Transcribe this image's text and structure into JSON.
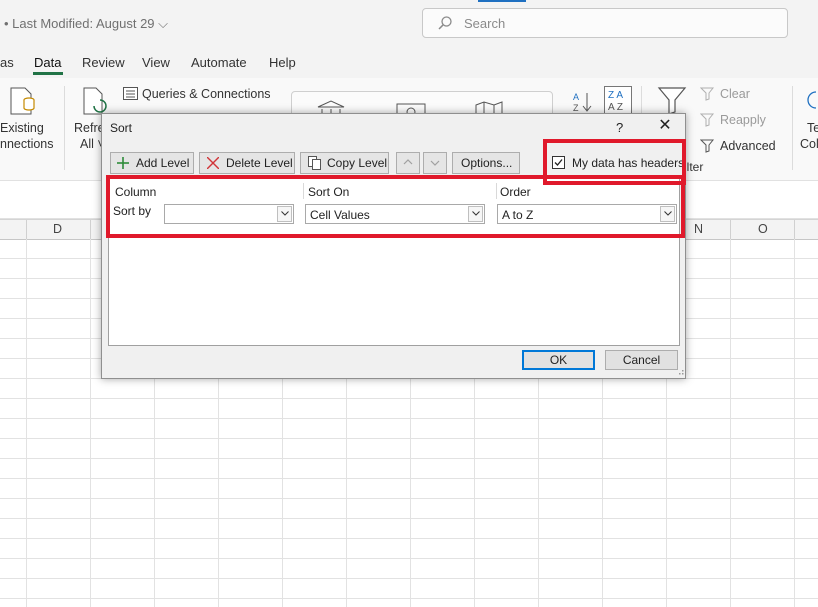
{
  "titlebar": {
    "last_modified": "• Last Modified: August 29 ⌵",
    "search_placeholder": "Search"
  },
  "menu_tabs": [
    {
      "label": "as"
    },
    {
      "label": "Data"
    },
    {
      "label": "Review"
    },
    {
      "label": "View"
    },
    {
      "label": "Automate"
    },
    {
      "label": "Help"
    }
  ],
  "ribbon": {
    "existing_connections": [
      "Existing",
      "nnections"
    ],
    "refresh_all": [
      "Refre",
      "All ˅"
    ],
    "queries_connections": "Queries & Connections",
    "clear": "Clear",
    "reapply": "Reapply",
    "advanced": "Advanced",
    "filter_fragment": "ilter",
    "text_to_columns": [
      "Te",
      "Col"
    ]
  },
  "sheet": {
    "columns": [
      {
        "letter": "D"
      },
      {
        "letter": "N"
      },
      {
        "letter": "O"
      }
    ]
  },
  "dialog": {
    "title": "Sort",
    "help": "?",
    "toolbar": {
      "add_level": "Add Level",
      "delete_level": "Delete Level",
      "copy_level": "Copy Level",
      "options": "Options...",
      "headers_checkbox_label": "My data has headers",
      "headers_checked": true
    },
    "columns_header": {
      "column": "Column",
      "sort_on": "Sort On",
      "order": "Order"
    },
    "row": {
      "label": "Sort by",
      "column_value": "",
      "sort_on_value": "Cell Values",
      "order_value": "A to Z"
    },
    "ok": "OK",
    "cancel": "Cancel"
  },
  "colors": {
    "annotation_red": "#e0192b",
    "excel_green": "#217346",
    "ok_border": "#0078d7"
  }
}
